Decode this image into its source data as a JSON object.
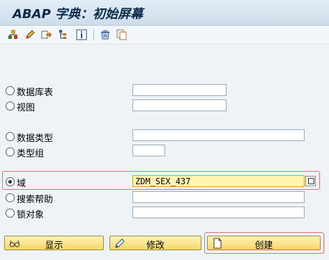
{
  "title": "ABAP 字典：初始屏幕",
  "toolbar": {
    "icons": [
      "hierarchy-icon",
      "pencil-icon",
      "export-icon",
      "tree-icon",
      "info-icon",
      "trash-icon",
      "copy-icon"
    ]
  },
  "options": {
    "db_table": {
      "label": "数据库表",
      "value": ""
    },
    "view": {
      "label": "视图",
      "value": ""
    },
    "data_type": {
      "label": "数据类型",
      "value": ""
    },
    "type_group": {
      "label": "类型组",
      "value": ""
    },
    "domain": {
      "label": "域",
      "value": "ZDM_SEX_437",
      "selected": true
    },
    "search_help": {
      "label": "搜索帮助",
      "value": ""
    },
    "lock_object": {
      "label": "锁对象",
      "value": ""
    }
  },
  "buttons": {
    "display": "显示",
    "change": "修改",
    "create": "创建"
  },
  "colors": {
    "title_bg": "#cdddea",
    "button_bg": "#f4d769",
    "highlight_border": "#e07070",
    "active_field": "#fff4b0"
  }
}
